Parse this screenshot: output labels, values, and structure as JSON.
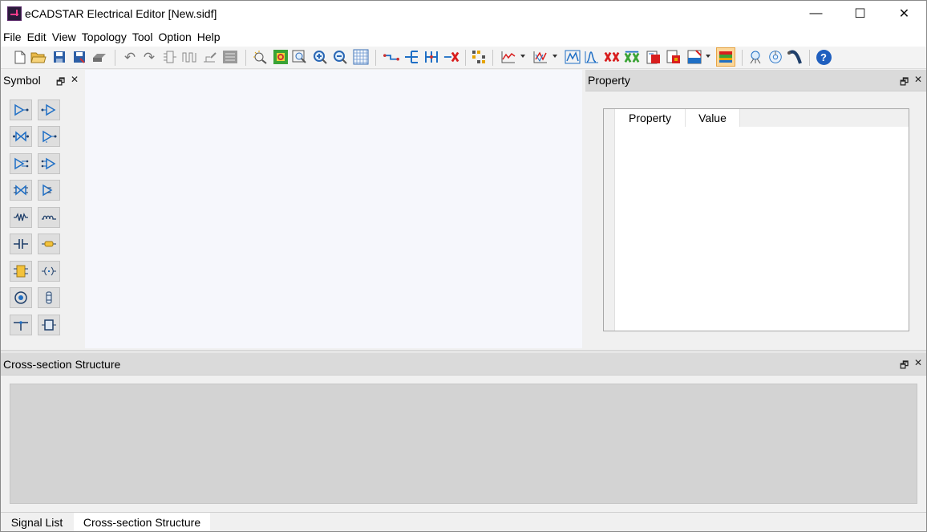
{
  "window": {
    "title": "eCADSTAR Electrical Editor [New.sidf]",
    "minimize_glyph": "—",
    "maximize_glyph": "☐",
    "close_glyph": "✕"
  },
  "menu": [
    {
      "label": "File"
    },
    {
      "label": "Edit"
    },
    {
      "label": "View"
    },
    {
      "label": "Topology"
    },
    {
      "label": "Tool"
    },
    {
      "label": "Option"
    },
    {
      "label": "Help"
    }
  ],
  "toolbar": {
    "icons": [
      "new-file-icon",
      "open-folder-icon",
      "save-icon",
      "save-as-icon",
      "print-icon",
      "undo-icon",
      "redo-icon",
      "component-icon",
      "waveform-icon",
      "net-edit-icon",
      "report-icon",
      "zoom-highlight-icon",
      "zoom-fit-icon",
      "zoom-window-icon",
      "zoom-in-icon",
      "zoom-out-icon",
      "grid-icon",
      "route-icon",
      "branch-icon",
      "multi-branch-icon",
      "delete-route-icon",
      "matrix-icon",
      "waveform-chart-icon",
      "eye-diagram-icon",
      "time-domain-icon",
      "frequency-icon",
      "crosstalk-icon",
      "crosstalk-sweep-icon",
      "export-sparam-icon",
      "export-report-icon",
      "spice-icon",
      "layer-stack-icon",
      "simulate-icon",
      "sweep-icon",
      "cable-icon",
      "help-icon"
    ],
    "help_glyph": "?"
  },
  "panels": {
    "symbol": {
      "title": "Symbol",
      "restore_glyph": "🗗",
      "close_glyph": "✕"
    },
    "property": {
      "title": "Property",
      "restore_glyph": "🗗",
      "close_glyph": "✕",
      "columns": [
        "Property",
        "Value"
      ]
    },
    "cross_section": {
      "title": "Cross-section Structure",
      "restore_glyph": "🗗",
      "close_glyph": "✕"
    }
  },
  "symbols": [
    "driver-icon",
    "receiver-icon",
    "bidirectional-icon",
    "driver-enable-icon",
    "differential-driver-icon",
    "differential-receiver-icon",
    "differential-bidirectional-icon",
    "differential-driver-enable-icon",
    "resistor-icon",
    "inductor-icon",
    "capacitor-icon",
    "fuse-icon",
    "connector-icon",
    "coupling-icon",
    "via-icon",
    "pin-icon",
    "ground-tap-icon",
    "package-icon"
  ],
  "tabs": [
    {
      "label": "Signal List",
      "active": false
    },
    {
      "label": "Cross-section Structure",
      "active": true
    }
  ],
  "colors": {
    "canvas": "#f6f7fc",
    "accent_blue": "#1f6fc5",
    "error_red": "#d81e1e"
  }
}
